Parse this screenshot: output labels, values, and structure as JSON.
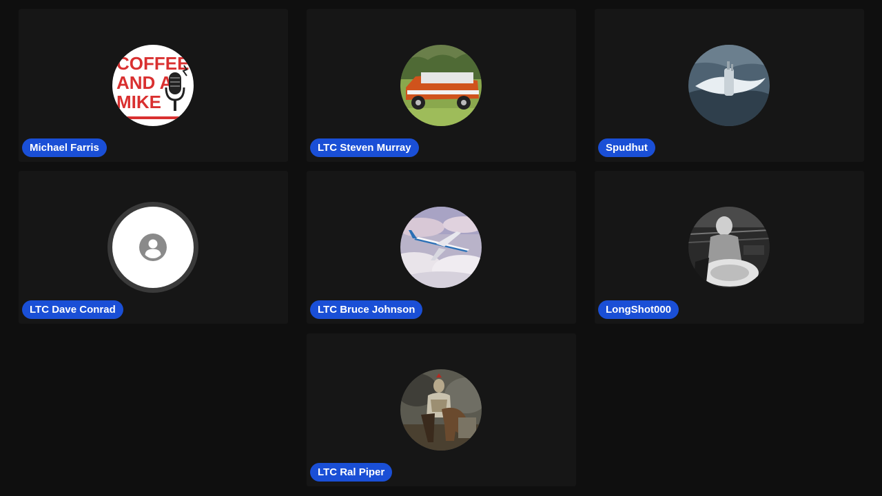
{
  "participants": [
    {
      "name": "Michael Farris",
      "avatar": "coffee-and-a-mike-logo-icon",
      "logo_text": [
        "COFFEE",
        "AND A",
        "MIKE"
      ]
    },
    {
      "name": "LTC Steven Murray",
      "avatar": "orange-truck-photo-icon"
    },
    {
      "name": "Spudhut",
      "avatar": "submarine-photo-icon"
    },
    {
      "name": "LTC Dave Conrad",
      "avatar": "default-user-icon"
    },
    {
      "name": "LTC Bruce Johnson",
      "avatar": "airplane-photo-icon"
    },
    {
      "name": "LongShot000",
      "avatar": "bw-portrait-photo-icon"
    },
    {
      "name": "LTC Ral Piper",
      "avatar": "cavalry-soldier-painting-icon"
    }
  ],
  "colors": {
    "background": "#0f0f0f",
    "tile": "#161616",
    "name_badge": "#1a4fd6",
    "name_text": "#ffffff"
  }
}
